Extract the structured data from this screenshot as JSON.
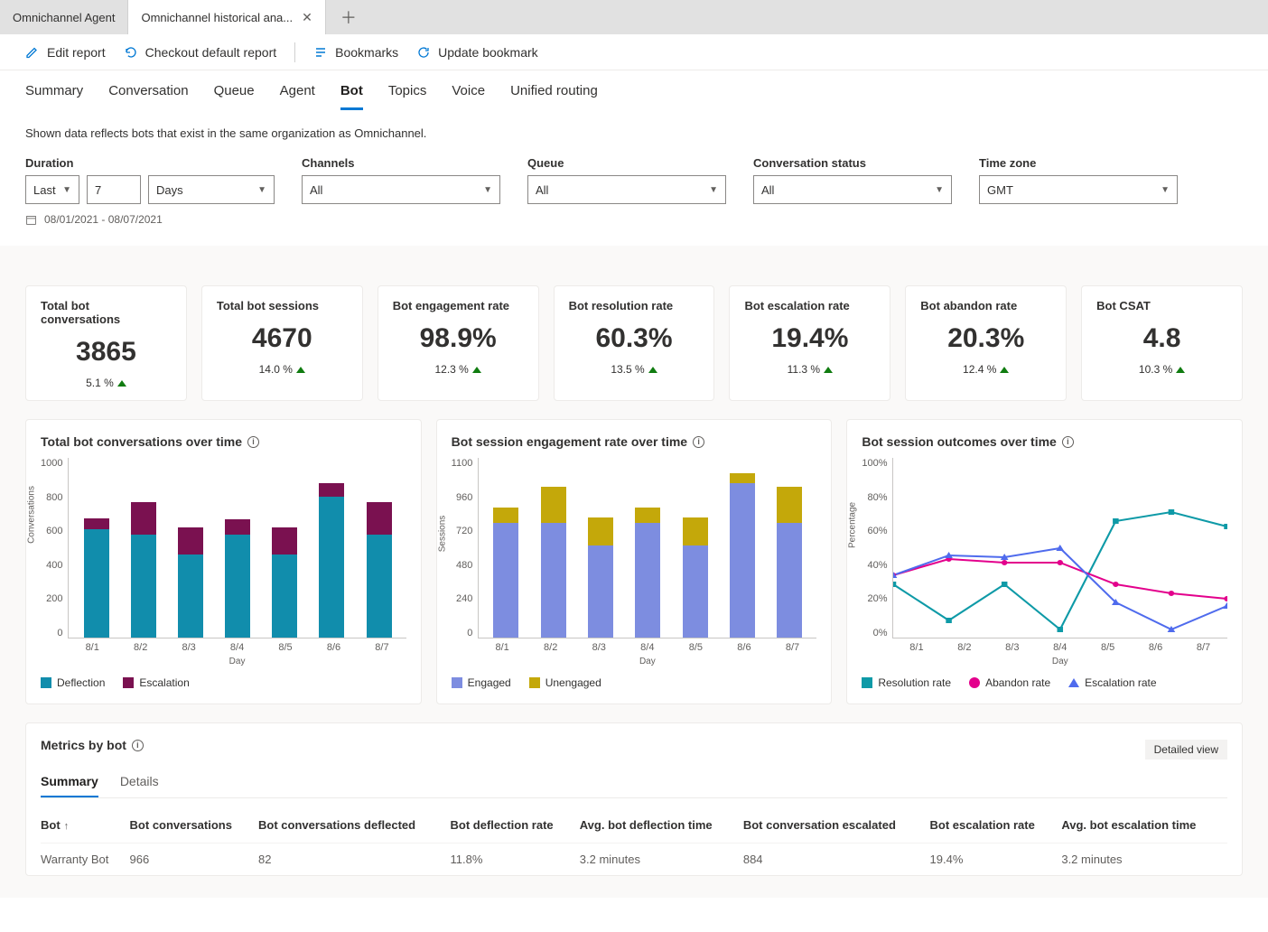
{
  "window_tabs": {
    "inactive": "Omnichannel Agent",
    "active": "Omnichannel historical ana..."
  },
  "toolbar": {
    "edit": "Edit report",
    "checkout": "Checkout default report",
    "bookmarks": "Bookmarks",
    "update": "Update bookmark"
  },
  "section_nav": [
    "Summary",
    "Conversation",
    "Queue",
    "Agent",
    "Bot",
    "Topics",
    "Voice",
    "Unified routing"
  ],
  "section_active": "Bot",
  "note": "Shown data reflects bots that exist in the same organization as Omnichannel.",
  "filters": {
    "duration_label": "Duration",
    "duration_mode": "Last",
    "duration_num": "7",
    "duration_unit": "Days",
    "channels_label": "Channels",
    "channels_value": "All",
    "queue_label": "Queue",
    "queue_value": "All",
    "status_label": "Conversation status",
    "status_value": "All",
    "tz_label": "Time zone",
    "tz_value": "GMT",
    "date_range": "08/01/2021 - 08/07/2021"
  },
  "kpis": [
    {
      "title": "Total bot conversations",
      "value": "3865",
      "delta": "5.1 %"
    },
    {
      "title": "Total bot sessions",
      "value": "4670",
      "delta": "14.0 %"
    },
    {
      "title": "Bot engagement rate",
      "value": "98.9%",
      "delta": "12.3 %"
    },
    {
      "title": "Bot resolution rate",
      "value": "60.3%",
      "delta": "13.5 %"
    },
    {
      "title": "Bot escalation rate",
      "value": "19.4%",
      "delta": "11.3 %"
    },
    {
      "title": "Bot abandon rate",
      "value": "20.3%",
      "delta": "12.4 %"
    },
    {
      "title": "Bot CSAT",
      "value": "4.8",
      "delta": "10.3 %"
    }
  ],
  "chart_data": [
    {
      "id": "conversations",
      "type": "bar",
      "title": "Total bot conversations over time",
      "categories": [
        "8/1",
        "8/2",
        "8/3",
        "8/4",
        "8/5",
        "8/6",
        "8/7"
      ],
      "series": [
        {
          "name": "Deflection",
          "color": "#118dac",
          "values": [
            600,
            570,
            460,
            570,
            460,
            780,
            570
          ]
        },
        {
          "name": "Escalation",
          "color": "#7a1150",
          "values": [
            60,
            180,
            150,
            85,
            150,
            75,
            180
          ]
        }
      ],
      "ylabel": "Conversations",
      "xlabel": "Day",
      "ylim": [
        0,
        1000
      ],
      "yticks": [
        0,
        200,
        400,
        600,
        800,
        1000
      ]
    },
    {
      "id": "engagement",
      "type": "bar",
      "title": "Bot session engagement rate over time",
      "categories": [
        "8/1",
        "8/2",
        "8/3",
        "8/4",
        "8/5",
        "8/6",
        "8/7"
      ],
      "series": [
        {
          "name": "Engaged",
          "color": "#7d8de0",
          "values": [
            700,
            700,
            560,
            700,
            560,
            940,
            700
          ]
        },
        {
          "name": "Unengaged",
          "color": "#c4a80a",
          "values": [
            90,
            220,
            170,
            90,
            170,
            60,
            220
          ]
        }
      ],
      "ylabel": "Sessions",
      "xlabel": "Day",
      "ylim": [
        0,
        1100
      ],
      "yticks": [
        0,
        240,
        480,
        720,
        960,
        1100
      ]
    },
    {
      "id": "outcomes",
      "type": "line",
      "title": "Bot session outcomes over time",
      "categories": [
        "8/1",
        "8/2",
        "8/3",
        "8/4",
        "8/5",
        "8/6",
        "8/7"
      ],
      "series": [
        {
          "name": "Resolution rate",
          "color": "#0e9aa7",
          "marker": "square",
          "values": [
            30,
            10,
            30,
            5,
            65,
            70,
            62
          ]
        },
        {
          "name": "Abandon rate",
          "color": "#e3008c",
          "marker": "circle",
          "values": [
            35,
            44,
            42,
            42,
            30,
            25,
            22
          ]
        },
        {
          "name": "Escalation rate",
          "color": "#4f6bed",
          "marker": "triangle",
          "values": [
            35,
            46,
            45,
            50,
            20,
            5,
            18
          ]
        }
      ],
      "ylabel": "Percentage",
      "xlabel": "Day",
      "ylim": [
        0,
        100
      ],
      "yticks": [
        0,
        20,
        40,
        60,
        80,
        100
      ]
    }
  ],
  "metrics_table": {
    "title": "Metrics by bot",
    "detailed": "Detailed view",
    "tabs": [
      "Summary",
      "Details"
    ],
    "active_tab": "Summary",
    "columns": [
      "Bot",
      "Bot conversations",
      "Bot conversations deflected",
      "Bot deflection rate",
      "Avg. bot deflection time",
      "Bot conversation escalated",
      "Bot escalation rate",
      "Avg. bot escalation time"
    ],
    "sort_col": "Bot",
    "rows": [
      {
        "Bot": "Warranty Bot",
        "Bot conversations": "966",
        "Bot conversations deflected": "82",
        "Bot deflection rate": "11.8%",
        "Avg. bot deflection time": "3.2 minutes",
        "Bot conversation escalated": "884",
        "Bot escalation rate": "19.4%",
        "Avg. bot escalation time": "3.2 minutes"
      }
    ]
  }
}
